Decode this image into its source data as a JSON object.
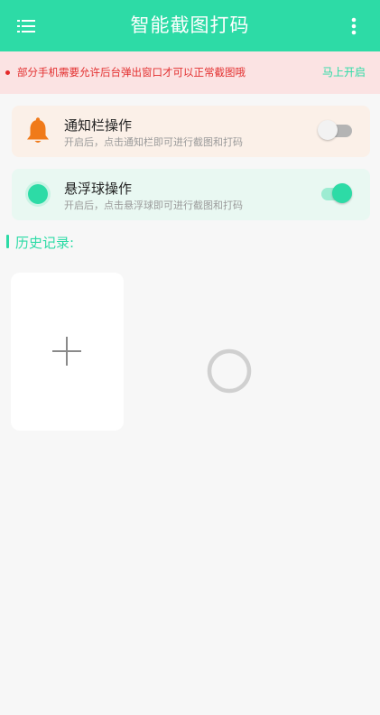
{
  "app": {
    "title": "智能截图打码"
  },
  "notice": {
    "message": "部分手机需要允许后台弹出窗口才可以正常截图哦",
    "action_label": "马上开启"
  },
  "cards": [
    {
      "title": "通知栏操作",
      "subtitle": "开启后，点击通知栏即可进行截图和打码",
      "icon": "bell-icon",
      "enabled": false
    },
    {
      "title": "悬浮球操作",
      "subtitle": "开启后，点击悬浮球即可进行截图和打码",
      "icon": "floating-ball-icon",
      "enabled": true
    }
  ],
  "history": {
    "label": "历史记录:"
  },
  "colors": {
    "primary": "#2ddba6",
    "warning_bg": "#fbe3e3",
    "warning_text": "#e33030",
    "bell": "#f07a1a"
  }
}
